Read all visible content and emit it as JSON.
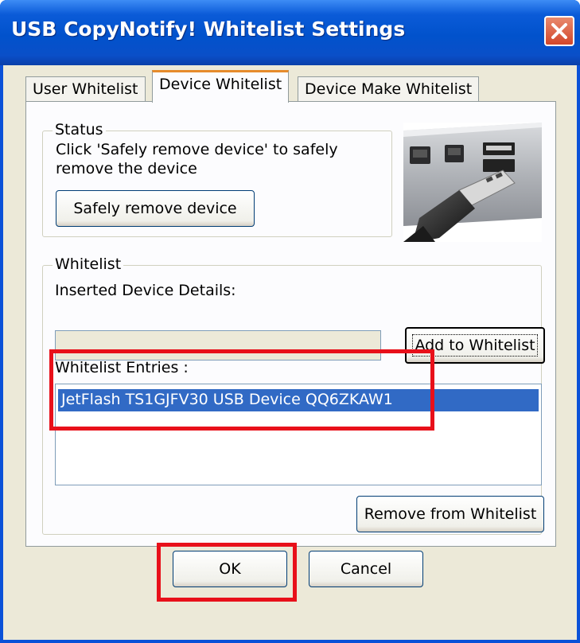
{
  "window": {
    "title": "USB CopyNotify! Whitelist Settings"
  },
  "tabs": [
    {
      "label": "User Whitelist",
      "active": false
    },
    {
      "label": "Device Whitelist",
      "active": true
    },
    {
      "label": "Device Make Whitelist",
      "active": false
    }
  ],
  "status": {
    "legend": "Status",
    "message_line1": "Click 'Safely remove device' to safely",
    "message_line2": "remove the device",
    "button_label": "Safely remove device"
  },
  "whitelist": {
    "legend": "Whitelist",
    "details_label": "Inserted Device Details:",
    "details_value": "",
    "add_button_label": "Add to Whitelist",
    "entries_label": "Whitelist Entries :",
    "entries": [
      "JetFlash TS1GJFV30 USB Device QQ6ZKAW1"
    ],
    "remove_button_label": "Remove from Whitelist"
  },
  "footer": {
    "ok_label": "OK",
    "cancel_label": "Cancel"
  },
  "colors": {
    "titlebar": "#0a51d8",
    "selection": "#316ac5",
    "highlight_box": "#e8101a"
  },
  "icons": {
    "close": "close-icon",
    "photo": "usb-port-photo"
  }
}
